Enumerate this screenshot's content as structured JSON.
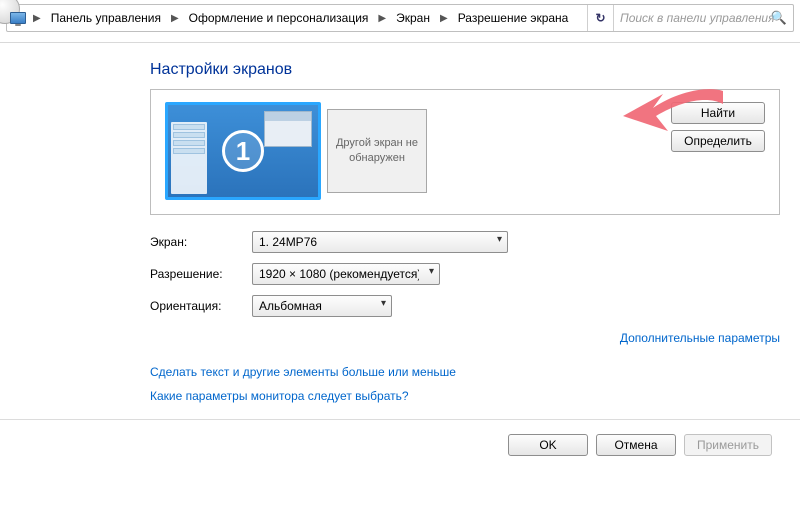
{
  "breadcrumb": {
    "items": [
      "Панель управления",
      "Оформление и персонализация",
      "Экран",
      "Разрешение экрана"
    ]
  },
  "search": {
    "placeholder": "Поиск в панели управления"
  },
  "title": "Настройки экранов",
  "preview": {
    "primary_number": "1",
    "secondary_text": "Другой экран не обнаружен",
    "find_label": "Найти",
    "identify_label": "Определить"
  },
  "form": {
    "screen_label": "Экран:",
    "screen_value": "1. 24MP76",
    "resolution_label": "Разрешение:",
    "resolution_value": "1920 × 1080 (рекомендуется)",
    "orientation_label": "Ориентация:",
    "orientation_value": "Альбомная",
    "advanced_link": "Дополнительные параметры"
  },
  "links": {
    "text_size": "Сделать текст и другие элементы больше или меньше",
    "which_monitor": "Какие параметры монитора следует выбрать?"
  },
  "buttons": {
    "ok": "OK",
    "cancel": "Отмена",
    "apply": "Применить"
  }
}
